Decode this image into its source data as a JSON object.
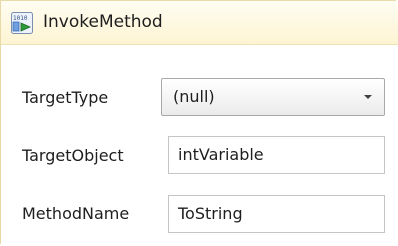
{
  "activity": {
    "title": "InvokeMethod",
    "icon": "invoke-method-icon"
  },
  "properties": {
    "target_type": {
      "label": "TargetType",
      "value": "(null)"
    },
    "target_object": {
      "label": "TargetObject",
      "value": "intVariable"
    },
    "method_name": {
      "label": "MethodName",
      "value": "ToString"
    }
  },
  "colors": {
    "header_background": "#fdf4d2",
    "header_border": "#f0e2b6",
    "input_border": "#c5c5c5",
    "text": "#1e1e1e"
  }
}
